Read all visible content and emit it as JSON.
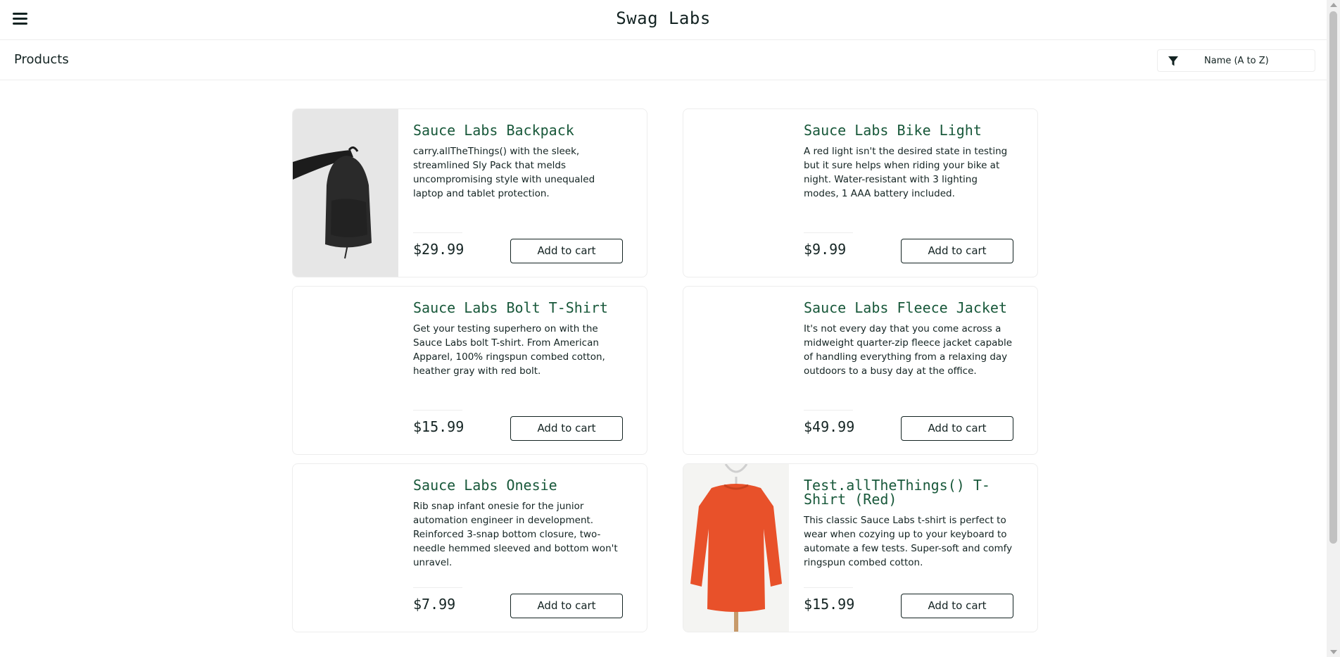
{
  "header": {
    "menu_icon": "hamburger-menu-icon",
    "logo": "Swag Labs"
  },
  "subheader": {
    "title": "Products",
    "sort_icon": "filter-icon",
    "sort_selected": "Name (A to Z)"
  },
  "products": [
    {
      "name": "Sauce Labs Backpack",
      "description": "carry.allTheThings() with the sleek, streamlined Sly Pack that melds uncompromising style with unequaled laptop and tablet protection.",
      "price": "$29.99",
      "button": "Add to cart",
      "image": "backpack"
    },
    {
      "name": "Sauce Labs Bike Light",
      "description": "A red light isn't the desired state in testing but it sure helps when riding your bike at night. Water-resistant with 3 lighting modes, 1 AAA battery included.",
      "price": "$9.99",
      "button": "Add to cart",
      "image": "none"
    },
    {
      "name": "Sauce Labs Bolt T-Shirt",
      "description": "Get your testing superhero on with the Sauce Labs bolt T-shirt. From American Apparel, 100% ringspun combed cotton, heather gray with red bolt.",
      "price": "$15.99",
      "button": "Add to cart",
      "image": "none"
    },
    {
      "name": "Sauce Labs Fleece Jacket",
      "description": "It's not every day that you come across a midweight quarter-zip fleece jacket capable of handling everything from a relaxing day outdoors to a busy day at the office.",
      "price": "$49.99",
      "button": "Add to cart",
      "image": "none"
    },
    {
      "name": "Sauce Labs Onesie",
      "description": "Rib snap infant onesie for the junior automation engineer in development. Reinforced 3-snap bottom closure, two-needle hemmed sleeved and bottom won't unravel.",
      "price": "$7.99",
      "button": "Add to cart",
      "image": "none"
    },
    {
      "name": "Test.allTheThings() T-Shirt (Red)",
      "description": "This classic Sauce Labs t-shirt is perfect to wear when cozying up to your keyboard to automate a few tests. Super-soft and comfy ringspun combed cotton.",
      "price": "$15.99",
      "button": "Add to cart",
      "image": "red-sweatshirt"
    }
  ],
  "colors": {
    "product_name": "#18583a",
    "text": "#132322",
    "border": "#ededed"
  }
}
